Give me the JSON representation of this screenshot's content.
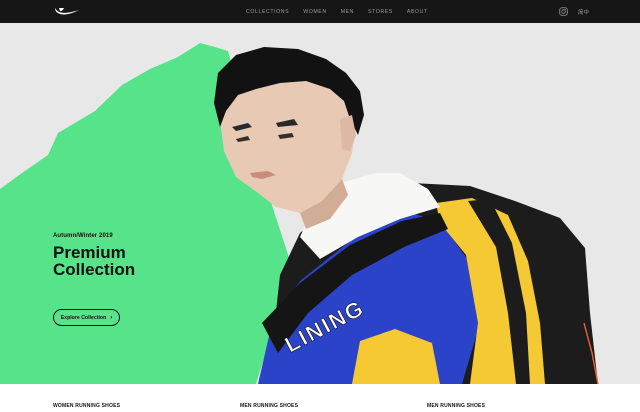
{
  "header": {
    "nav": [
      "COLLECTIONS",
      "WOMEN",
      "MEN",
      "STORES",
      "ABOUT"
    ],
    "language_label": "简中"
  },
  "hero": {
    "season": "Autumn/Winter 2019",
    "title": "Premium Collection",
    "cta_label": "Explore Collection",
    "jacket_text": "LINING",
    "accent_color": "#57e389",
    "background_color": "#e8e8e8"
  },
  "categories": [
    "WOMEN RUNNING SHOES",
    "MEN RUNNING SHOES",
    "MEN RUNNING SHOES"
  ],
  "colors": {
    "topbar": "#161616",
    "text": "#111111"
  }
}
